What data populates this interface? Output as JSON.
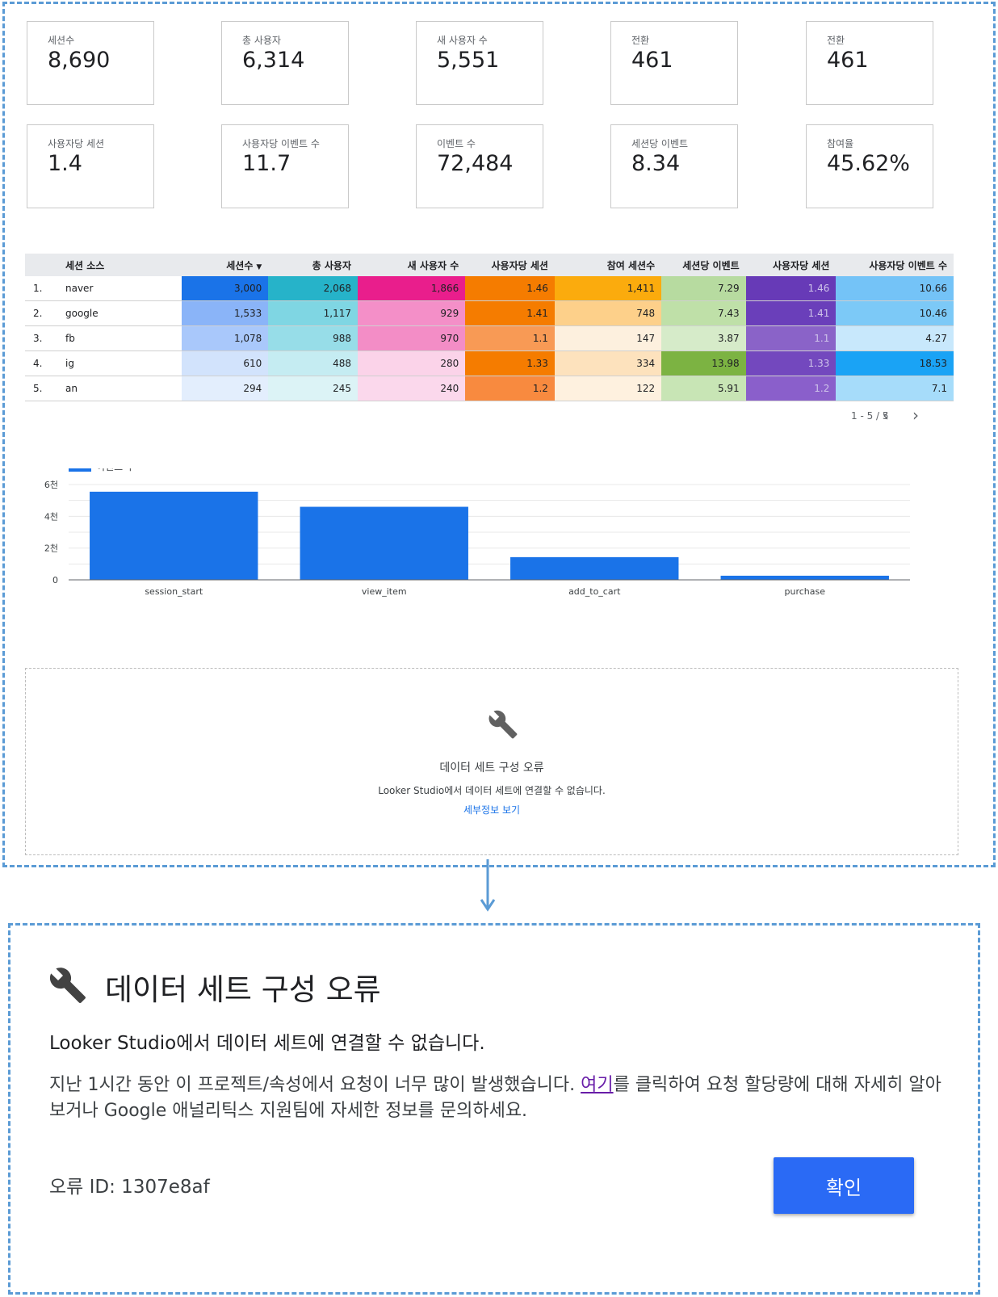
{
  "scorecards": [
    {
      "label": "세션수",
      "value": "8,690"
    },
    {
      "label": "총 사용자",
      "value": "6,314"
    },
    {
      "label": "새 사용자 수",
      "value": "5,551"
    },
    {
      "label": "전환",
      "value": "461"
    },
    {
      "label": "전환",
      "value": "461"
    },
    {
      "label": "사용자당 세션",
      "value": "1.4"
    },
    {
      "label": "사용자당 이벤트 수",
      "value": "11.7"
    },
    {
      "label": "이벤트 수",
      "value": "72,484"
    },
    {
      "label": "세션당 이벤트",
      "value": "8.34"
    },
    {
      "label": "참여율",
      "value": "45.62%"
    }
  ],
  "table": {
    "headers": [
      "세션 소스",
      "세션수",
      "총 사용자",
      "새 사용자 수",
      "사용자당 세션",
      "참여 세션수",
      "세션당 이벤트",
      "사용자당 세션",
      "사용자당 이벤트 수"
    ],
    "sort_indicator": "▼",
    "rows": [
      {
        "num": "1.",
        "source": "naver",
        "cells": [
          "3,000",
          "2,068",
          "1,866",
          "1.46",
          "1,411",
          "7.29",
          "1.46",
          "10.66"
        ]
      },
      {
        "num": "2.",
        "source": "google",
        "cells": [
          "1,533",
          "1,117",
          "929",
          "1.41",
          "748",
          "7.43",
          "1.41",
          "10.46"
        ]
      },
      {
        "num": "3.",
        "source": "fb",
        "cells": [
          "1,078",
          "988",
          "970",
          "1.1",
          "147",
          "3.87",
          "1.1",
          "4.27"
        ]
      },
      {
        "num": "4.",
        "source": "ig",
        "cells": [
          "610",
          "488",
          "280",
          "1.33",
          "334",
          "13.98",
          "1.33",
          "18.53"
        ]
      },
      {
        "num": "5.",
        "source": "an",
        "cells": [
          "294",
          "245",
          "240",
          "1.2",
          "122",
          "5.91",
          "1.2",
          "7.1"
        ]
      }
    ],
    "cell_colors": [
      [
        "#1a73e8",
        "#26b3c9",
        "#e91e8c",
        "#f57c00",
        "#fbab0d",
        "#b7dba0",
        "#673ab7",
        "#74c3f7"
      ],
      [
        "#8ab4f8",
        "#7fd6e3",
        "#f48fc8",
        "#f57c00",
        "#fdd08a",
        "#bfe0a8",
        "#6a3fba",
        "#7cc9f7"
      ],
      [
        "#a9c8fb",
        "#97dde8",
        "#f38dc6",
        "#f89a55",
        "#fdf0de",
        "#d6ebc9",
        "#8a63c8",
        "#c8e8fc"
      ],
      [
        "#d2e3fc",
        "#c5ecf2",
        "#fbd3e9",
        "#f57c00",
        "#fde2bd",
        "#7cb342",
        "#7348be",
        "#1aa3f5"
      ],
      [
        "#e3eefd",
        "#dcf3f6",
        "#fbd8ec",
        "#f88a3f",
        "#fef1df",
        "#c8e5b5",
        "#8a5fcb",
        "#a6dcfa"
      ]
    ],
    "dark_text_cells": [
      [
        false,
        false,
        false,
        false,
        false,
        false,
        true,
        false
      ],
      [
        false,
        false,
        false,
        false,
        false,
        false,
        true,
        false
      ],
      [
        false,
        false,
        false,
        false,
        false,
        false,
        true,
        false
      ],
      [
        false,
        false,
        false,
        false,
        false,
        false,
        true,
        false
      ],
      [
        false,
        false,
        false,
        false,
        false,
        false,
        true,
        false
      ]
    ],
    "pager": "1 - 5 / 5"
  },
  "chart_data": {
    "type": "bar",
    "categories": [
      "session_start",
      "view_item",
      "add_to_cart",
      "purchase"
    ],
    "series": [
      {
        "name": "이벤트 수",
        "values": [
          5550,
          4600,
          1430,
          260
        ],
        "color": "#1a73e8"
      }
    ],
    "ylim": [
      0,
      6000
    ],
    "yticks": [
      {
        "value": 0,
        "label": "0"
      },
      {
        "value": 2000,
        "label": "2천"
      },
      {
        "value": 4000,
        "label": "4천"
      },
      {
        "value": 6000,
        "label": "6천"
      }
    ],
    "legend_position": "top-left",
    "grid": true
  },
  "error_panel": {
    "title": "데이터 세트 구성 오류",
    "message": "Looker Studio에서 데이터 세트에 연결할 수 없습니다.",
    "link": "세부정보 보기"
  },
  "dialog": {
    "title": "데이터 세트 구성 오류",
    "subtitle": "Looker Studio에서 데이터 세트에 연결할 수 없습니다.",
    "body_before": "지난 1시간 동안 이 프로젝트/속성에서 요청이 너무 많이 발생했습니다. ",
    "body_link": "여기",
    "body_after": "를 클릭하여 요청 할당량에 대해 자세히 알아보거나 Google 애널리틱스 지원팀에 자세한 정보를 문의하세요.",
    "error_id": "오류 ID: 1307e8af",
    "ok_label": "확인"
  },
  "colors": {
    "frame": "#5b9bd5",
    "accent": "#1a73e8",
    "button": "#2a6af5"
  }
}
